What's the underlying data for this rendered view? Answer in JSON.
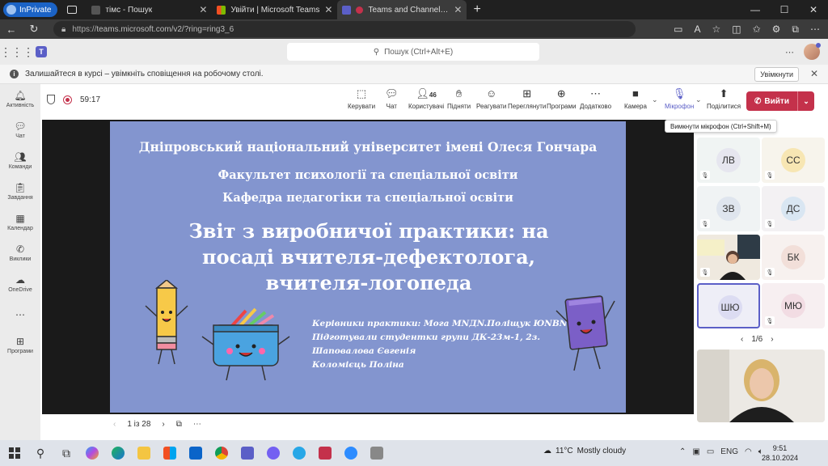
{
  "browser": {
    "inprivate_label": "InPrivate",
    "tabs": [
      {
        "title": "тімс - Пошук",
        "favicon_color": "#2b2b2b"
      },
      {
        "title": "Увійти | Microsoft Teams",
        "favicon_color": "#f25022"
      },
      {
        "title": "Teams and Channels | Захис",
        "favicon_color": "#5b5fc7"
      }
    ],
    "url_prefix": "https://",
    "url": "teams.microsoft.com/v2/?ring=ring3_6"
  },
  "teams_bar": {
    "search_placeholder": "Пошук (Ctrl+Alt+E)"
  },
  "notice": {
    "text": "Залишайтеся в курсі – увімкніть сповіщення на робочому столі.",
    "enable_label": "Увімкнути"
  },
  "rail": [
    {
      "label": "Активність",
      "icon": "bell-icon"
    },
    {
      "label": "Чат",
      "icon": "chat-icon"
    },
    {
      "label": "Команди",
      "icon": "teams-icon"
    },
    {
      "label": "Завдання",
      "icon": "assignments-icon"
    },
    {
      "label": "Календар",
      "icon": "calendar-icon"
    },
    {
      "label": "Виклики",
      "icon": "phone-icon"
    },
    {
      "label": "OneDrive",
      "icon": "cloud-icon"
    },
    {
      "label": "Програми",
      "icon": "apps-icon"
    }
  ],
  "meeting": {
    "timer": "59:17",
    "participants_count": "46",
    "toolbar": {
      "control": "Керувати",
      "chat": "Чат",
      "people": "Користувачі",
      "raise": "Підняти",
      "react": "Реагувати",
      "view": "Переглянути",
      "apps": "Програми",
      "more": "Додатково",
      "camera": "Камера",
      "mic": "Мікрофон",
      "share": "Поділитися",
      "leave": "Вийти"
    },
    "mic_tooltip": "Вимкнути мікрофон (Ctrl+Shift+M)"
  },
  "slide": {
    "university": "Дніпровський національний університет імені Олеся Гончара",
    "faculty": "Факультет психології та спеціальної освіти",
    "department": "Кафедра педагогіки та спеціальної освіти",
    "title_lines": [
      "Звіт з виробничої практики: на",
      "посаді вчителя-дефектолога,",
      "вчителя-логопеда"
    ],
    "info_lines": [
      "Керівники практики: Мога МNДN.Поліщук ЮNBN",
      "Підготували студентки групи ДК-23м-1, 2з.",
      "Шаповалова Євгенія",
      "Коломієць Поліна"
    ],
    "page_indicator": "1 із 28"
  },
  "participants": {
    "tiles": [
      {
        "initials": "ЛВ",
        "bg": "#e6e6ef",
        "tile_bg": "#f0f4f3"
      },
      {
        "initials": "СС",
        "bg": "#f7e6b3",
        "tile_bg": "#f7f4ec"
      },
      {
        "initials": "ЗВ",
        "bg": "#dfe5ee",
        "tile_bg": "#f0f3f4"
      },
      {
        "initials": "ДС",
        "bg": "#d9e6f2",
        "tile_bg": "#f3f1f3"
      },
      {
        "initials": "БК",
        "bg": "#f2dfd9",
        "tile_bg": "#f7f1ef"
      },
      {
        "initials": "ШЮ",
        "bg": "#dcdcf2",
        "tile_bg": "#eeeef7"
      },
      {
        "initials": "МЮ",
        "bg": "#f2dce3",
        "tile_bg": "#f7eff1"
      }
    ],
    "pager": "1/6"
  },
  "taskbar": {
    "weather_temp": "11°C",
    "weather_text": "Mostly cloudy",
    "lang": "ENG",
    "time": "9:51",
    "date": "28.10.2024"
  }
}
